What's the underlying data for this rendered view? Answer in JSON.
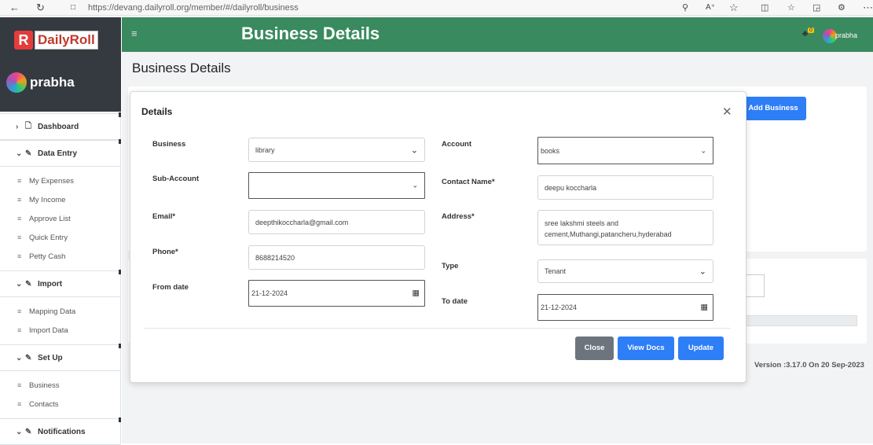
{
  "browser": {
    "url": "https://devang.dailyroll.org/member/#/dailyroll/business"
  },
  "sidebar": {
    "logo_letter": "R",
    "logo_text": "DailyRoll",
    "user_name": "prabha",
    "sections": [
      {
        "label": "Dashboard",
        "icon": "file-icon",
        "items": []
      },
      {
        "label": "Data Entry",
        "icon": "pencil-icon",
        "items": [
          "My Expenses",
          "My Income",
          "Approve List",
          "Quick Entry",
          "Petty Cash"
        ]
      },
      {
        "label": "Import",
        "icon": "pencil-icon",
        "items": [
          "Mapping Data",
          "Import Data"
        ]
      },
      {
        "label": "Set Up",
        "icon": "pencil-icon",
        "items": [
          "Business",
          "Contacts"
        ]
      },
      {
        "label": "Notifications",
        "icon": "pencil-icon",
        "items": []
      }
    ]
  },
  "header": {
    "menu_icon": "hamburger-icon",
    "title": "Business Details",
    "notification_count": "0",
    "user_name": "prabha"
  },
  "main": {
    "page_title": "Business Details",
    "add_business_label": "Add Business",
    "version": "Version :3.17.0 On 20 Sep-2023"
  },
  "modal": {
    "title": "Details",
    "fields": {
      "business": {
        "label": "Business",
        "value": "library"
      },
      "account": {
        "label": "Account",
        "value": "books"
      },
      "sub_account": {
        "label": "Sub-Account",
        "value": ""
      },
      "contact_name": {
        "label": "Contact Name*",
        "value": "deepu koccharla"
      },
      "email": {
        "label": "Email*",
        "value": "deepthikoccharla@gmail.com"
      },
      "address": {
        "label": "Address*",
        "value": "sree lakshmi steels and cement,Muthangi,patancheru,hyderabad"
      },
      "phone": {
        "label": "Phone*",
        "value": "8688214520"
      },
      "type": {
        "label": "Type",
        "value": "Tenant"
      },
      "from_date": {
        "label": "From date",
        "value": "21-12-2024"
      },
      "to_date": {
        "label": "To date",
        "value": "21-12-2024"
      }
    },
    "buttons": {
      "close": "Close",
      "view_docs": "View Docs",
      "update": "Update"
    }
  },
  "colors": {
    "header_green": "#3a8a5f",
    "primary_blue": "#2d7ef7",
    "close_gray": "#6c757d",
    "sidebar_dark": "#343a40"
  }
}
